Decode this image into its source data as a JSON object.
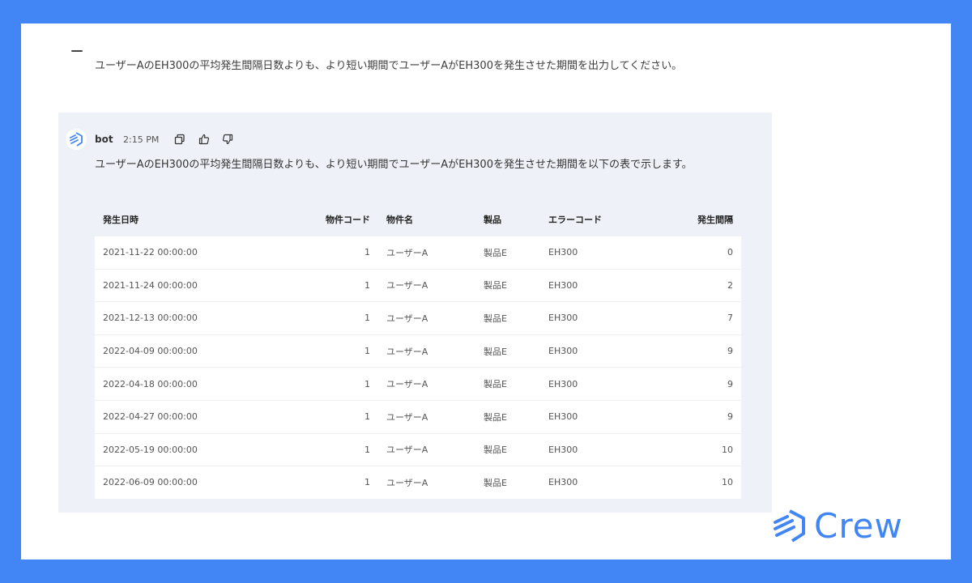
{
  "user": {
    "message": "ユーザーAのEH300の平均発生間隔日数よりも、より短い期間でユーザーAがEH300を発生させた期間を出力してください。"
  },
  "bot": {
    "name": "bot",
    "time": "2:15 PM",
    "message": "ユーザーAのEH300の平均発生間隔日数よりも、より短い期間でユーザーAがEH300を発生させた期間を以下の表で示します。",
    "actions": [
      "copy-icon",
      "thumbs-up-icon",
      "thumbs-down-icon"
    ]
  },
  "table": {
    "headers": [
      "発生日時",
      "物件コード",
      "物件名",
      "製品",
      "エラーコード",
      "発生間隔"
    ],
    "rows": [
      [
        "2021-11-22 00:00:00",
        "1",
        "ユーザーA",
        "製品E",
        "EH300",
        "0"
      ],
      [
        "2021-11-24 00:00:00",
        "1",
        "ユーザーA",
        "製品E",
        "EH300",
        "2"
      ],
      [
        "2021-12-13 00:00:00",
        "1",
        "ユーザーA",
        "製品E",
        "EH300",
        "7"
      ],
      [
        "2022-04-09 00:00:00",
        "1",
        "ユーザーA",
        "製品E",
        "EH300",
        "9"
      ],
      [
        "2022-04-18 00:00:00",
        "1",
        "ユーザーA",
        "製品E",
        "EH300",
        "9"
      ],
      [
        "2022-04-27 00:00:00",
        "1",
        "ユーザーA",
        "製品E",
        "EH300",
        "9"
      ],
      [
        "2022-05-19 00:00:00",
        "1",
        "ユーザーA",
        "製品E",
        "EH300",
        "10"
      ],
      [
        "2022-06-09 00:00:00",
        "1",
        "ユーザーA",
        "製品E",
        "EH300",
        "10"
      ]
    ]
  },
  "brand": {
    "logo_text": "Crew",
    "color": "#4285f4"
  }
}
